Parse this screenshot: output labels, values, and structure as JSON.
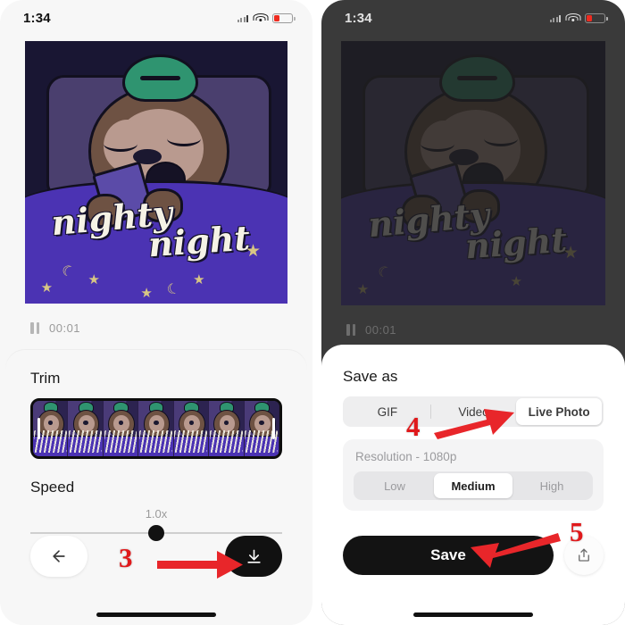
{
  "left_phone": {
    "status_bar": {
      "time": "1:34",
      "wifi_icon": "wifi-icon",
      "battery_icon": "battery-low-icon",
      "signal_icon": "cellular-signal-icon"
    },
    "preview": {
      "artwork_text_line1": "nighty",
      "artwork_text_line2": "night",
      "alt": "sleeping sloth holding phone in bed"
    },
    "playback": {
      "pause_icon": "pause-icon",
      "timecode": "00:01"
    },
    "editor": {
      "trim_label": "Trim",
      "speed_label": "Speed",
      "speed_value": "1.0x",
      "trim_handle_left": "trim-handle-left",
      "trim_handle_right": "trim-handle-right"
    },
    "actions": {
      "back_icon": "arrow-left-icon",
      "download_icon": "download-icon"
    }
  },
  "right_phone": {
    "status_bar": {
      "time": "1:34",
      "wifi_icon": "wifi-icon",
      "battery_icon": "battery-low-icon",
      "signal_icon": "cellular-signal-icon"
    },
    "playback": {
      "pause_icon": "pause-icon",
      "timecode": "00:01"
    },
    "sheet": {
      "title": "Save as",
      "format_options": [
        {
          "label": "GIF",
          "selected": false
        },
        {
          "label": "Video",
          "selected": false
        },
        {
          "label": "Live Photo",
          "selected": true
        }
      ],
      "resolution_label": "Resolution - 1080p",
      "quality_options": [
        {
          "label": "Low",
          "selected": false
        },
        {
          "label": "Medium",
          "selected": true
        },
        {
          "label": "High",
          "selected": false
        }
      ],
      "save_label": "Save",
      "share_icon": "share-upload-icon"
    }
  },
  "annotations": {
    "step3": "3",
    "step4": "4",
    "step5": "5",
    "arrow_color": "#E8262A",
    "number_color": "#E0191B"
  }
}
